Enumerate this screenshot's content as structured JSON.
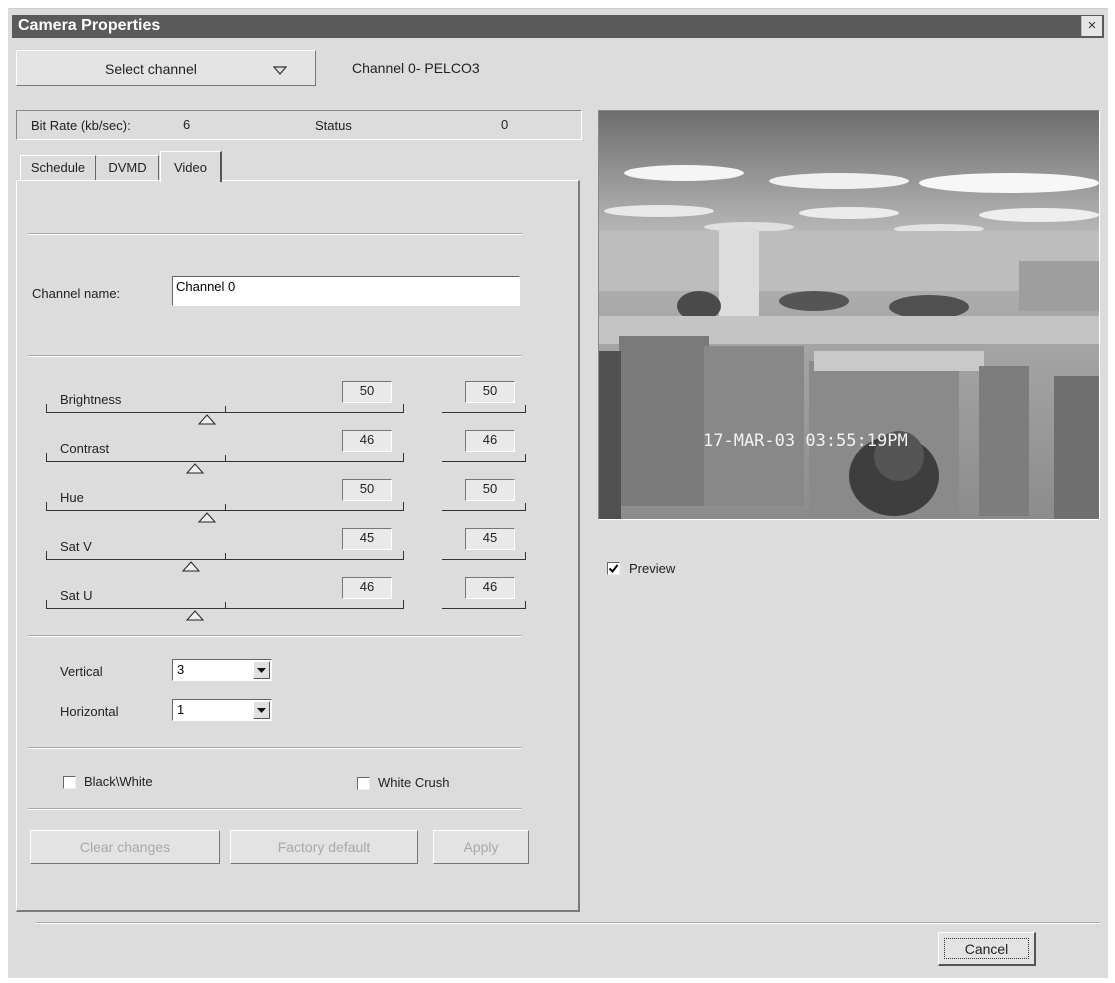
{
  "window": {
    "title": "Camera Properties",
    "close_symbol": "×"
  },
  "header": {
    "select_channel_label": "Select channel",
    "channel_info": "Channel 0- PELCO3"
  },
  "status_bar": {
    "bitrate_label": "Bit Rate (kb/sec):",
    "bitrate_value": "6",
    "status_label": "Status",
    "status_value": "0"
  },
  "tabs": [
    {
      "label": "Schedule"
    },
    {
      "label": "DVMD"
    },
    {
      "label": "Video",
      "active": true
    }
  ],
  "channel_name": {
    "label": "Channel name:",
    "value": "Channel 0"
  },
  "sliders": [
    {
      "label": "Brightness",
      "value": "50",
      "default": "50",
      "position": 0.5
    },
    {
      "label": "Contrast",
      "value": "46",
      "default": "46",
      "position": 0.46
    },
    {
      "label": "Hue",
      "value": "50",
      "default": "50",
      "position": 0.5
    },
    {
      "label": "Sat V",
      "value": "45",
      "default": "45",
      "position": 0.45
    },
    {
      "label": "Sat U",
      "value": "46",
      "default": "46",
      "position": 0.46
    }
  ],
  "vertical": {
    "label": "Vertical",
    "value": "3"
  },
  "horizontal": {
    "label": "Horizontal",
    "value": "1"
  },
  "checkboxes": {
    "black_white": {
      "label": "Black\\White",
      "checked": false
    },
    "white_crush": {
      "label": "White Crush",
      "checked": false
    }
  },
  "buttons": {
    "clear_changes": "Clear changes",
    "factory_default": "Factory default",
    "apply": "Apply",
    "cancel": "Cancel"
  },
  "preview": {
    "timestamp": "17-MAR-03  03:55:19PM",
    "checkbox_label": "Preview",
    "checked": true
  },
  "colors": {
    "title_bar": "#5a5a5a",
    "dialog_bg": "#dcdcdc",
    "disabled_text": "#a8a8a8"
  }
}
